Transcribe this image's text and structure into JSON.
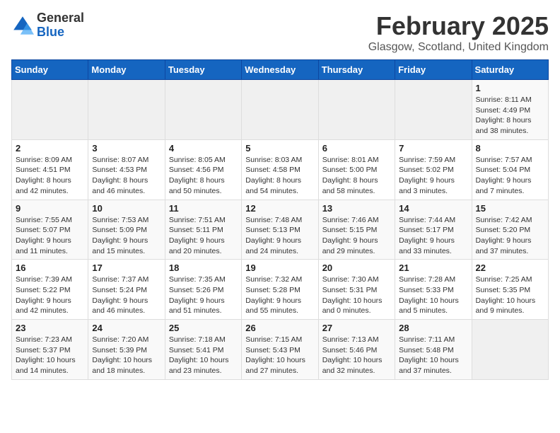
{
  "logo": {
    "general": "General",
    "blue": "Blue"
  },
  "title": "February 2025",
  "location": "Glasgow, Scotland, United Kingdom",
  "days_of_week": [
    "Sunday",
    "Monday",
    "Tuesday",
    "Wednesday",
    "Thursday",
    "Friday",
    "Saturday"
  ],
  "weeks": [
    [
      {
        "day": "",
        "info": ""
      },
      {
        "day": "",
        "info": ""
      },
      {
        "day": "",
        "info": ""
      },
      {
        "day": "",
        "info": ""
      },
      {
        "day": "",
        "info": ""
      },
      {
        "day": "",
        "info": ""
      },
      {
        "day": "1",
        "info": "Sunrise: 8:11 AM\nSunset: 4:49 PM\nDaylight: 8 hours and 38 minutes."
      }
    ],
    [
      {
        "day": "2",
        "info": "Sunrise: 8:09 AM\nSunset: 4:51 PM\nDaylight: 8 hours and 42 minutes."
      },
      {
        "day": "3",
        "info": "Sunrise: 8:07 AM\nSunset: 4:53 PM\nDaylight: 8 hours and 46 minutes."
      },
      {
        "day": "4",
        "info": "Sunrise: 8:05 AM\nSunset: 4:56 PM\nDaylight: 8 hours and 50 minutes."
      },
      {
        "day": "5",
        "info": "Sunrise: 8:03 AM\nSunset: 4:58 PM\nDaylight: 8 hours and 54 minutes."
      },
      {
        "day": "6",
        "info": "Sunrise: 8:01 AM\nSunset: 5:00 PM\nDaylight: 8 hours and 58 minutes."
      },
      {
        "day": "7",
        "info": "Sunrise: 7:59 AM\nSunset: 5:02 PM\nDaylight: 9 hours and 3 minutes."
      },
      {
        "day": "8",
        "info": "Sunrise: 7:57 AM\nSunset: 5:04 PM\nDaylight: 9 hours and 7 minutes."
      }
    ],
    [
      {
        "day": "9",
        "info": "Sunrise: 7:55 AM\nSunset: 5:07 PM\nDaylight: 9 hours and 11 minutes."
      },
      {
        "day": "10",
        "info": "Sunrise: 7:53 AM\nSunset: 5:09 PM\nDaylight: 9 hours and 15 minutes."
      },
      {
        "day": "11",
        "info": "Sunrise: 7:51 AM\nSunset: 5:11 PM\nDaylight: 9 hours and 20 minutes."
      },
      {
        "day": "12",
        "info": "Sunrise: 7:48 AM\nSunset: 5:13 PM\nDaylight: 9 hours and 24 minutes."
      },
      {
        "day": "13",
        "info": "Sunrise: 7:46 AM\nSunset: 5:15 PM\nDaylight: 9 hours and 29 minutes."
      },
      {
        "day": "14",
        "info": "Sunrise: 7:44 AM\nSunset: 5:17 PM\nDaylight: 9 hours and 33 minutes."
      },
      {
        "day": "15",
        "info": "Sunrise: 7:42 AM\nSunset: 5:20 PM\nDaylight: 9 hours and 37 minutes."
      }
    ],
    [
      {
        "day": "16",
        "info": "Sunrise: 7:39 AM\nSunset: 5:22 PM\nDaylight: 9 hours and 42 minutes."
      },
      {
        "day": "17",
        "info": "Sunrise: 7:37 AM\nSunset: 5:24 PM\nDaylight: 9 hours and 46 minutes."
      },
      {
        "day": "18",
        "info": "Sunrise: 7:35 AM\nSunset: 5:26 PM\nDaylight: 9 hours and 51 minutes."
      },
      {
        "day": "19",
        "info": "Sunrise: 7:32 AM\nSunset: 5:28 PM\nDaylight: 9 hours and 55 minutes."
      },
      {
        "day": "20",
        "info": "Sunrise: 7:30 AM\nSunset: 5:31 PM\nDaylight: 10 hours and 0 minutes."
      },
      {
        "day": "21",
        "info": "Sunrise: 7:28 AM\nSunset: 5:33 PM\nDaylight: 10 hours and 5 minutes."
      },
      {
        "day": "22",
        "info": "Sunrise: 7:25 AM\nSunset: 5:35 PM\nDaylight: 10 hours and 9 minutes."
      }
    ],
    [
      {
        "day": "23",
        "info": "Sunrise: 7:23 AM\nSunset: 5:37 PM\nDaylight: 10 hours and 14 minutes."
      },
      {
        "day": "24",
        "info": "Sunrise: 7:20 AM\nSunset: 5:39 PM\nDaylight: 10 hours and 18 minutes."
      },
      {
        "day": "25",
        "info": "Sunrise: 7:18 AM\nSunset: 5:41 PM\nDaylight: 10 hours and 23 minutes."
      },
      {
        "day": "26",
        "info": "Sunrise: 7:15 AM\nSunset: 5:43 PM\nDaylight: 10 hours and 27 minutes."
      },
      {
        "day": "27",
        "info": "Sunrise: 7:13 AM\nSunset: 5:46 PM\nDaylight: 10 hours and 32 minutes."
      },
      {
        "day": "28",
        "info": "Sunrise: 7:11 AM\nSunset: 5:48 PM\nDaylight: 10 hours and 37 minutes."
      },
      {
        "day": "",
        "info": ""
      }
    ]
  ]
}
